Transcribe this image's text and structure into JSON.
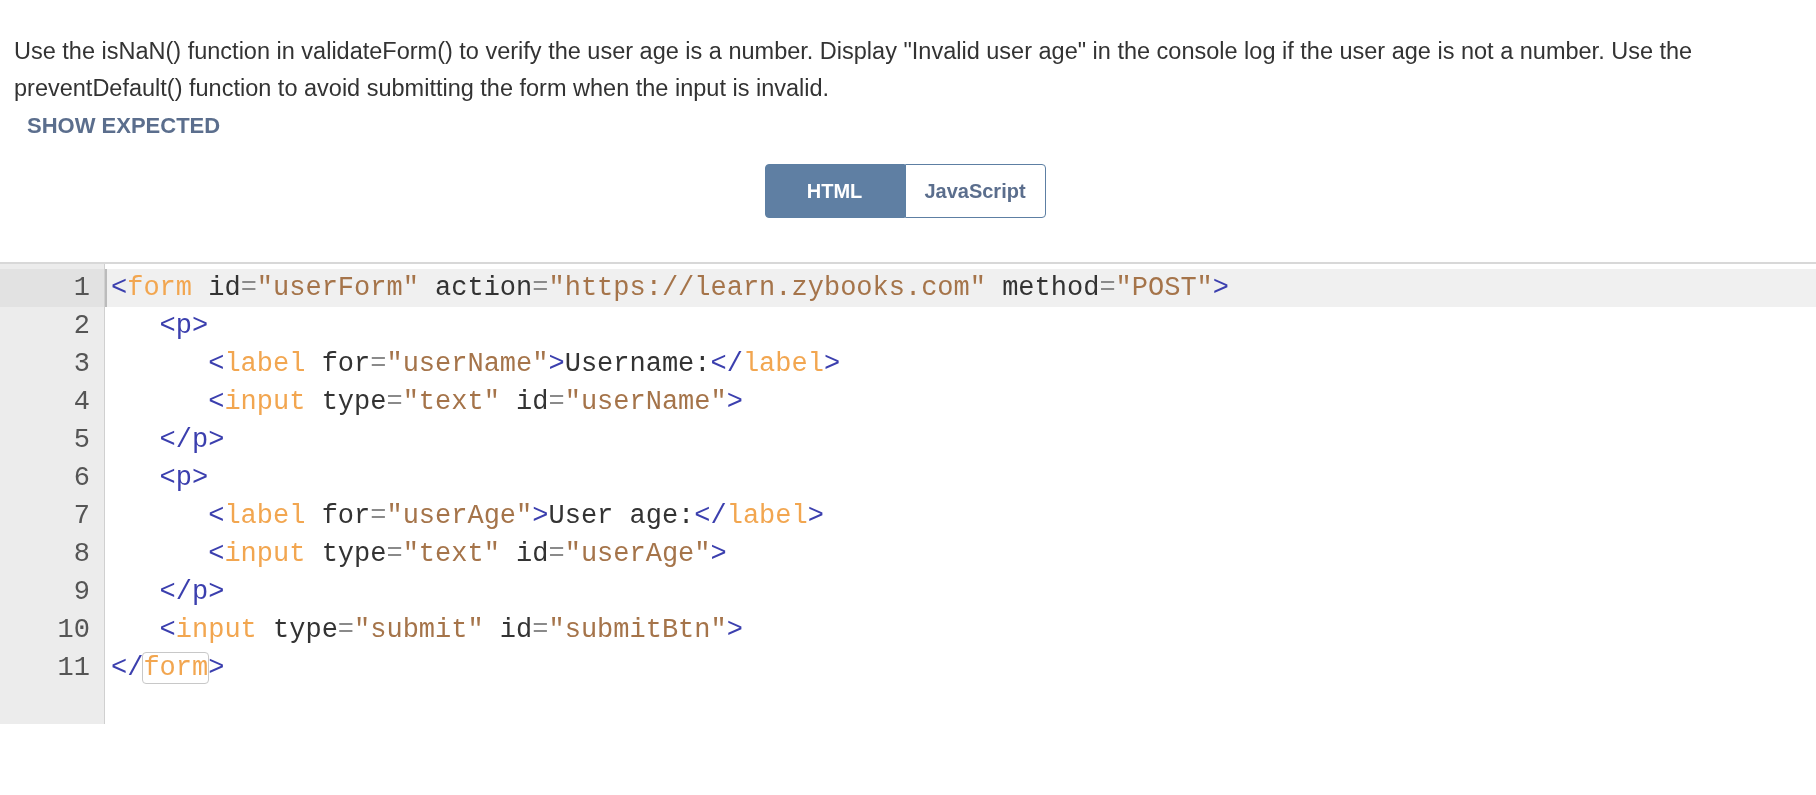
{
  "instructions": "Use the isNaN() function in validateForm() to verify the user age is a number. Display \"Invalid user age\" in the console log if the user age is not a number. Use the preventDefault() function to avoid submitting the form when the input is invalid.",
  "show_expected": "SHOW EXPECTED",
  "tabs": [
    {
      "label": "HTML",
      "selected": true
    },
    {
      "label": "JavaScript",
      "selected": false
    }
  ],
  "editor": {
    "lines": [
      {
        "number": "1",
        "active": true,
        "tokens": [
          {
            "kind": "bracket",
            "text": "<"
          },
          {
            "kind": "tag",
            "text": "form"
          },
          {
            "kind": "attr",
            "text": " id"
          },
          {
            "kind": "eq",
            "text": "="
          },
          {
            "kind": "string",
            "text": "\"userForm\""
          },
          {
            "kind": "attr",
            "text": " action"
          },
          {
            "kind": "eq",
            "text": "="
          },
          {
            "kind": "string",
            "text": "\"https://learn.zybooks.com\""
          },
          {
            "kind": "attr",
            "text": " method"
          },
          {
            "kind": "eq",
            "text": "="
          },
          {
            "kind": "string",
            "text": "\"POST\""
          },
          {
            "kind": "bracket",
            "text": ">"
          }
        ]
      },
      {
        "number": "2",
        "active": false,
        "tokens": [
          {
            "kind": "bracket",
            "text": "   <p>"
          }
        ]
      },
      {
        "number": "3",
        "active": false,
        "tokens": [
          {
            "kind": "bracket",
            "text": "      <"
          },
          {
            "kind": "tag",
            "text": "label"
          },
          {
            "kind": "attr",
            "text": " for"
          },
          {
            "kind": "eq",
            "text": "="
          },
          {
            "kind": "string",
            "text": "\"userName\""
          },
          {
            "kind": "bracket",
            "text": ">"
          },
          {
            "kind": "text",
            "text": "Username:"
          },
          {
            "kind": "bracket",
            "text": "</"
          },
          {
            "kind": "tag",
            "text": "label"
          },
          {
            "kind": "bracket",
            "text": ">"
          }
        ]
      },
      {
        "number": "4",
        "active": false,
        "tokens": [
          {
            "kind": "bracket",
            "text": "      <"
          },
          {
            "kind": "tag",
            "text": "input"
          },
          {
            "kind": "attr",
            "text": " type"
          },
          {
            "kind": "eq",
            "text": "="
          },
          {
            "kind": "string",
            "text": "\"text\""
          },
          {
            "kind": "attr",
            "text": " id"
          },
          {
            "kind": "eq",
            "text": "="
          },
          {
            "kind": "string",
            "text": "\"userName\""
          },
          {
            "kind": "bracket",
            "text": ">"
          }
        ]
      },
      {
        "number": "5",
        "active": false,
        "tokens": [
          {
            "kind": "bracket",
            "text": "   </p>"
          }
        ]
      },
      {
        "number": "6",
        "active": false,
        "tokens": [
          {
            "kind": "bracket",
            "text": "   <p>"
          }
        ]
      },
      {
        "number": "7",
        "active": false,
        "tokens": [
          {
            "kind": "bracket",
            "text": "      <"
          },
          {
            "kind": "tag",
            "text": "label"
          },
          {
            "kind": "attr",
            "text": " for"
          },
          {
            "kind": "eq",
            "text": "="
          },
          {
            "kind": "string",
            "text": "\"userAge\""
          },
          {
            "kind": "bracket",
            "text": ">"
          },
          {
            "kind": "text",
            "text": "User age:"
          },
          {
            "kind": "bracket",
            "text": "</"
          },
          {
            "kind": "tag",
            "text": "label"
          },
          {
            "kind": "bracket",
            "text": ">"
          }
        ]
      },
      {
        "number": "8",
        "active": false,
        "tokens": [
          {
            "kind": "bracket",
            "text": "      <"
          },
          {
            "kind": "tag",
            "text": "input"
          },
          {
            "kind": "attr",
            "text": " type"
          },
          {
            "kind": "eq",
            "text": "="
          },
          {
            "kind": "string",
            "text": "\"text\""
          },
          {
            "kind": "attr",
            "text": " id"
          },
          {
            "kind": "eq",
            "text": "="
          },
          {
            "kind": "string",
            "text": "\"userAge\""
          },
          {
            "kind": "bracket",
            "text": ">"
          }
        ]
      },
      {
        "number": "9",
        "active": false,
        "tokens": [
          {
            "kind": "bracket",
            "text": "   </p>"
          }
        ]
      },
      {
        "number": "10",
        "active": false,
        "tokens": [
          {
            "kind": "bracket",
            "text": "   <"
          },
          {
            "kind": "tag",
            "text": "input"
          },
          {
            "kind": "attr",
            "text": " type"
          },
          {
            "kind": "eq",
            "text": "="
          },
          {
            "kind": "string",
            "text": "\"submit\""
          },
          {
            "kind": "attr",
            "text": " id"
          },
          {
            "kind": "eq",
            "text": "="
          },
          {
            "kind": "string",
            "text": "\"submitBtn\""
          },
          {
            "kind": "bracket",
            "text": ">"
          }
        ]
      },
      {
        "number": "11",
        "active": false,
        "tokens": [
          {
            "kind": "bracket",
            "text": "</"
          },
          {
            "kind": "matched-tag",
            "text": "form"
          },
          {
            "kind": "bracket",
            "text": ">"
          }
        ]
      }
    ]
  }
}
